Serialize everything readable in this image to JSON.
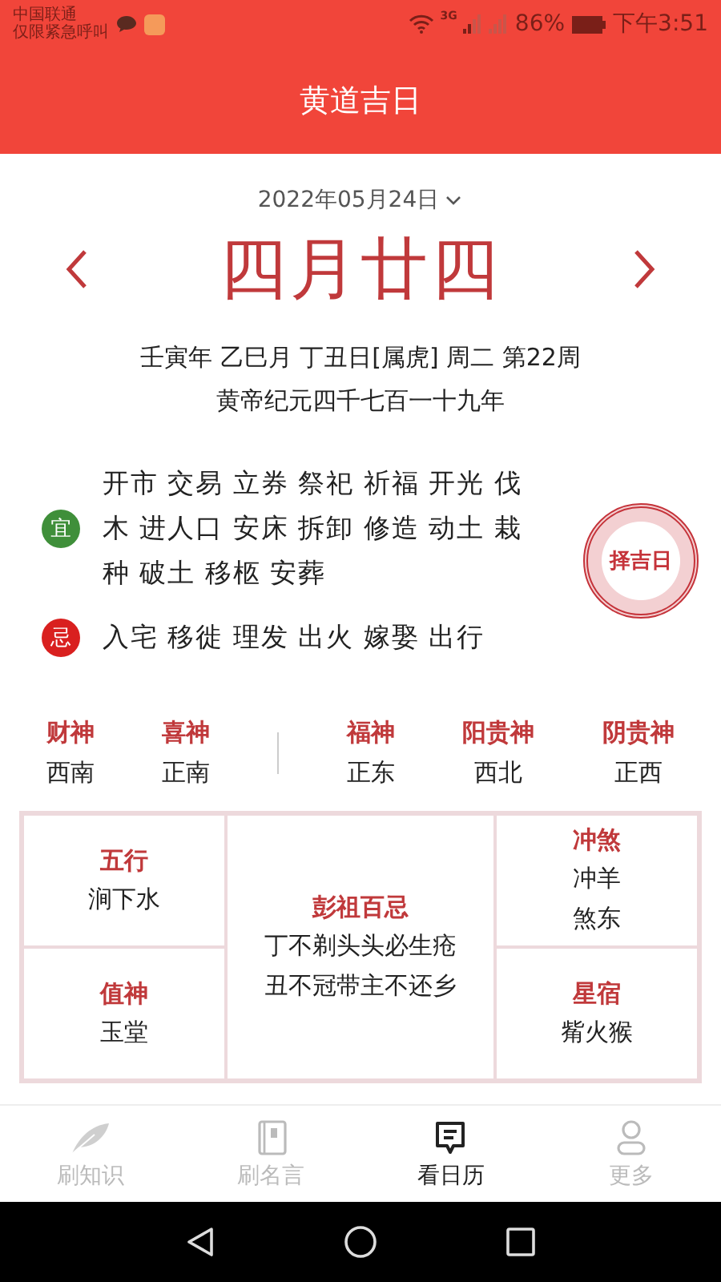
{
  "status_bar": {
    "carrier_lines": [
      "中国联通",
      "仅限紧急呼叫"
    ],
    "network": "3G",
    "battery": "86%",
    "time": "下午3:51"
  },
  "header": {
    "title": "黄道吉日"
  },
  "date": {
    "selector": "2022年05月24日",
    "lunar": "四月廿四",
    "details": [
      "壬寅年 乙巳月 丁丑日[属虎] 周二 第22周",
      "黄帝纪元四千七百一十九年"
    ]
  },
  "activities": [
    {
      "badge": "宜",
      "color": "#3f8f3a",
      "text": "开市 交易 立券 祭祀 祈福 开光 伐木 进人口 安床 拆卸 修造 动土 栽种 破土 移柩 安葬"
    },
    {
      "badge": "忌",
      "color": "#d9201f",
      "text": "入宅 移徙 理发 出火 嫁娶 出行"
    }
  ],
  "stamp": {
    "label": "择吉日"
  },
  "god_groups": [
    [
      {
        "name": "财神",
        "direction": "西南"
      },
      {
        "name": "喜神",
        "direction": "正南"
      }
    ],
    [
      {
        "name": "福神",
        "direction": "正东"
      },
      {
        "name": "阳贵神",
        "direction": "西北"
      },
      {
        "name": "阴贵神",
        "direction": "正西"
      }
    ]
  ],
  "almanac": {
    "left": [
      {
        "title": "五行",
        "lines": [
          "涧下水"
        ]
      },
      {
        "title": "值神",
        "lines": [
          "玉堂"
        ]
      }
    ],
    "center": {
      "title": "彭祖百忌",
      "lines": [
        "丁不剃头头必生疮",
        "丑不冠带主不还乡"
      ]
    },
    "right": [
      {
        "title": "冲煞",
        "lines": [
          "冲羊",
          "煞东"
        ]
      },
      {
        "title": "星宿",
        "lines": [
          "觜火猴"
        ]
      }
    ]
  },
  "tabs": [
    {
      "kind": "feather",
      "label": "刷知识",
      "selected": false
    },
    {
      "kind": "notebook",
      "label": "刷名言",
      "selected": false
    },
    {
      "kind": "message",
      "label": "看日历",
      "selected": true
    },
    {
      "kind": "person",
      "label": "更多",
      "selected": false
    }
  ]
}
